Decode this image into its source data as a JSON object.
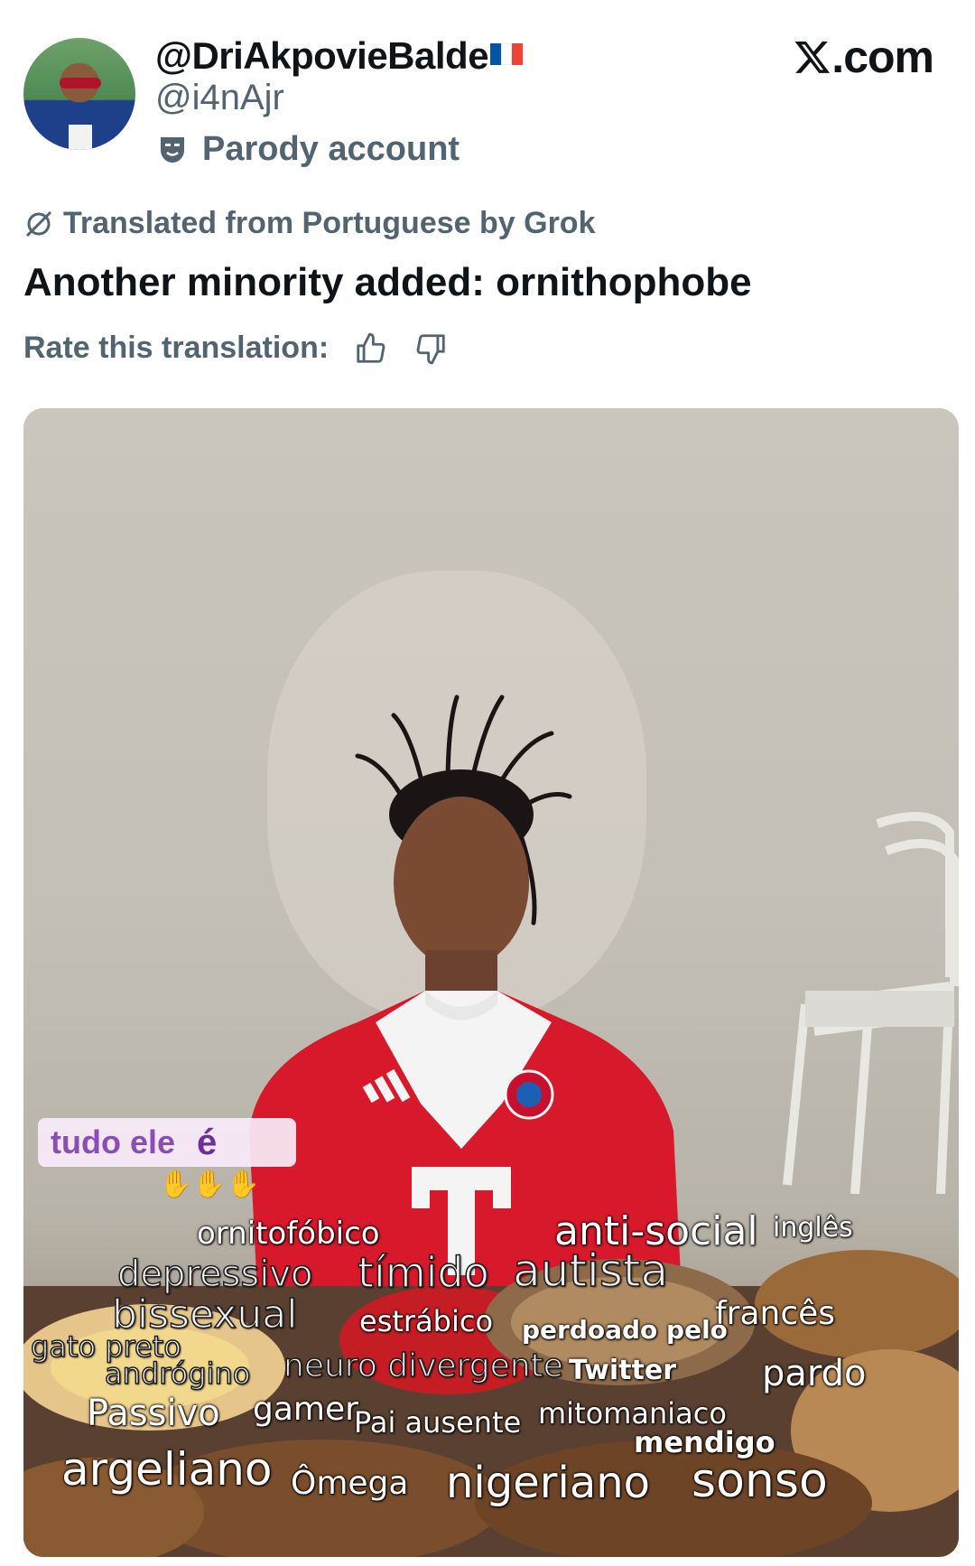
{
  "header": {
    "display_name": "@DriAkpovieBalde",
    "handle": "@i4nAjr",
    "parody_label": "Parody account",
    "site": ".com",
    "flag_colors": [
      "#0055a4",
      "#ffffff",
      "#ef4135"
    ]
  },
  "translation": {
    "notice": "Translated from Portuguese by Grok",
    "tweet_text": "Another minority added: ornithophobe",
    "rate_label": "Rate this translation:"
  },
  "image": {
    "caption_top": "tudo ele",
    "caption_e": "é",
    "words": {
      "w1": "ornitofóbico",
      "w2": "anti-social",
      "w3": "inglês",
      "w4": "depressivo",
      "w5": "tímido",
      "w6": "autista",
      "w7": "bissexual",
      "w8": "estrábico",
      "w9": "francês",
      "w10": "perdoado pelo",
      "w11": "gato preto",
      "w12": "andrógino",
      "w13": "neuro divergente",
      "w14": "Twitter",
      "w15": "pardo",
      "w16": "Passivo",
      "w17": "gamer",
      "w18": "Pai ausente",
      "w19": "mitomaniaco",
      "w20": "mendigo",
      "w21": "argeliano",
      "w22": "Ômega",
      "w23": "nigeriano",
      "w24": "sonso"
    },
    "jersey_letter": "T",
    "jersey_colors": {
      "red": "#d7192b",
      "white": "#f4f4f4"
    }
  },
  "icons": [
    "avatar",
    "flag-fr-icon",
    "parody-mask-icon",
    "x-logo-icon",
    "grok-slash-icon",
    "thumbs-up-icon",
    "thumbs-down-icon"
  ]
}
